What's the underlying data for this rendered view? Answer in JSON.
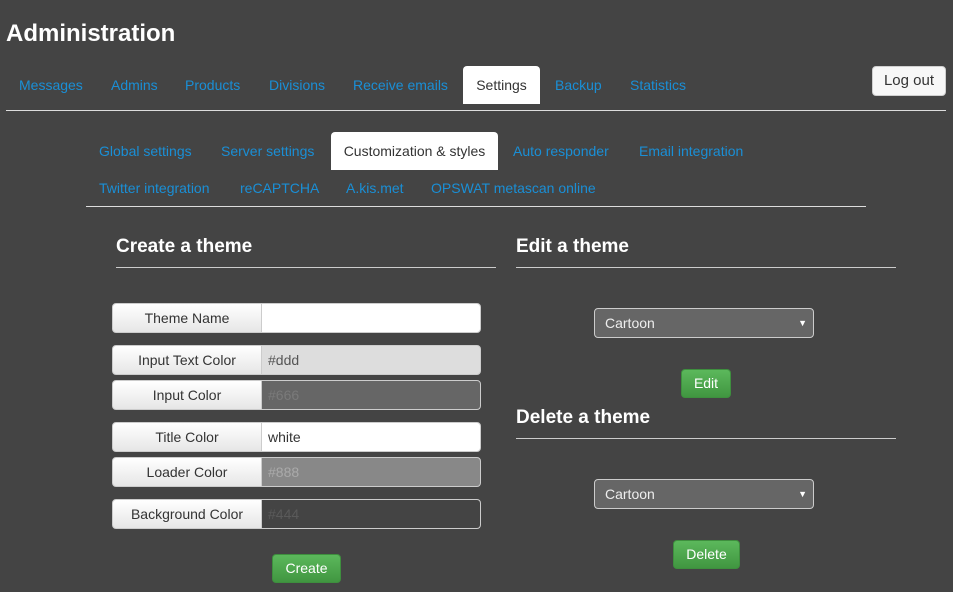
{
  "header": {
    "title": "Administration",
    "logout_label": "Log out"
  },
  "main_tabs": [
    {
      "label": "Messages"
    },
    {
      "label": "Admins"
    },
    {
      "label": "Products"
    },
    {
      "label": "Divisions"
    },
    {
      "label": "Receive emails"
    },
    {
      "label": "Settings",
      "active": true
    },
    {
      "label": "Backup"
    },
    {
      "label": "Statistics"
    }
  ],
  "sub_tabs": [
    {
      "label": "Global settings"
    },
    {
      "label": "Server settings"
    },
    {
      "label": "Customization & styles",
      "active": true
    },
    {
      "label": "Auto responder"
    },
    {
      "label": "Email integration"
    },
    {
      "label": "Twitter integration"
    },
    {
      "label": "reCAPTCHA"
    },
    {
      "label": "A.kis.met"
    },
    {
      "label": "OPSWAT metascan online"
    }
  ],
  "create_theme": {
    "title": "Create a theme",
    "fields": [
      {
        "label": "Theme Name",
        "value": ""
      },
      {
        "label": "Input Text Color",
        "value": "#ddd"
      },
      {
        "label": "Input Color",
        "value": "#666"
      },
      {
        "label": "Title Color",
        "value": "white"
      },
      {
        "label": "Loader Color",
        "value": "#888"
      },
      {
        "label": "Background Color",
        "value": "#444"
      }
    ],
    "button_label": "Create"
  },
  "edit_theme": {
    "title": "Edit a theme",
    "selected": "Cartoon",
    "button_label": "Edit"
  },
  "delete_theme": {
    "title": "Delete a theme",
    "selected": "Cartoon",
    "button_label": "Delete"
  },
  "colors": {
    "background": "#444444",
    "link": "#1a8fd6",
    "button_green": "#5cb85c",
    "select_bg": "#666666"
  }
}
